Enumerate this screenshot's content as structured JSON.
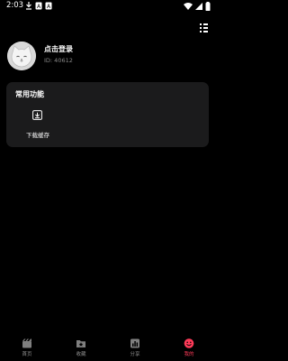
{
  "status_bar": {
    "time": "2:03",
    "icons": [
      "download-icon",
      "a-icon",
      "a-icon",
      "wifi-icon",
      "signal-icon",
      "battery-icon"
    ]
  },
  "profile": {
    "name": "点击登录",
    "id": "ID: 40612"
  },
  "common_functions": {
    "title": "常用功能",
    "items": [
      {
        "label": "下载缓存",
        "icon": "download-icon"
      }
    ]
  },
  "tabs": [
    {
      "label": "首页",
      "icon": "clapperboard-icon",
      "active": false
    },
    {
      "label": "收藏",
      "icon": "folder-star-icon",
      "active": false
    },
    {
      "label": "分享",
      "icon": "share-chart-icon",
      "active": false
    },
    {
      "label": "我的",
      "icon": "smiley-icon",
      "active": true
    }
  ],
  "colors": {
    "background": "#000000",
    "card": "#1b1b1c",
    "accent": "#ff3b59",
    "muted_text": "#8a8a8a"
  }
}
